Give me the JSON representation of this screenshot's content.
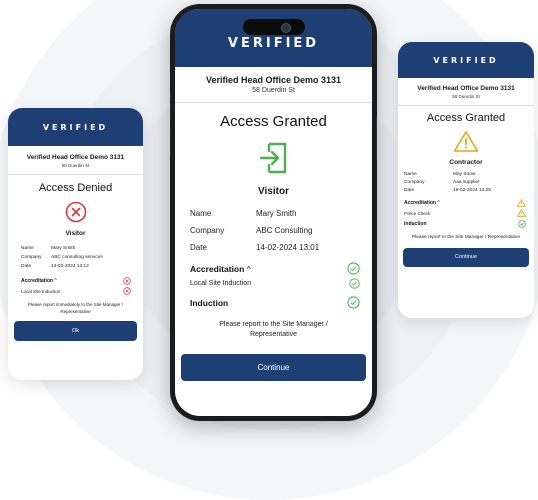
{
  "brand": {
    "logo_text": "VERIFIED",
    "header_color": "#1d3f73"
  },
  "colors": {
    "granted_green": "#4caf50",
    "denied_red": "#d63a3a",
    "warning_amber": "#e8a317"
  },
  "center": {
    "site_name": "Verified Head Office Demo 3131",
    "site_address": "58 Duerdin St",
    "status": "Access Granted",
    "status_icon": "door-enter-icon",
    "role": "Visitor",
    "fields": [
      {
        "label": "Name",
        "value": "Mary Smith"
      },
      {
        "label": "Company",
        "value": "ABC Consulting"
      },
      {
        "label": "Date",
        "value": "14-02-2024 13:01"
      }
    ],
    "accreditation_label": "Accreditation",
    "accreditation_items": [
      {
        "label": "Local Site Induction",
        "status": "ok"
      }
    ],
    "induction_label": "Induction",
    "note": "Please report to the Site Manager / Representative",
    "button_label": "Continue"
  },
  "left": {
    "site_name": "Verified Head Office Demo 3131",
    "site_address": "58 Duerdin St",
    "status": "Access Denied",
    "status_icon": "x-circle-icon",
    "role": "Visitor",
    "fields": [
      {
        "label": "Name",
        "value": "Mary Smith"
      },
      {
        "label": "Company",
        "value": "ABC consulting services"
      },
      {
        "label": "Date",
        "value": "14-02-2024 13:12"
      }
    ],
    "accreditation_label": "Accreditation",
    "accreditation_items": [
      {
        "label": "Local Site Induction",
        "status": "denied"
      }
    ],
    "note": "Please report immediately to the Site Manager / Representative",
    "button_label": "Ok"
  },
  "right": {
    "site_name": "Verified Head Office Demo 3131",
    "site_address": "58 Duerdin St",
    "status": "Access Granted",
    "status_icon": "warning-triangle-icon",
    "role": "Contractor",
    "fields": [
      {
        "label": "Name",
        "value": "May Snow"
      },
      {
        "label": "Company",
        "value": "Aaa supplier"
      },
      {
        "label": "Date",
        "value": "19-02-2024 13:25"
      }
    ],
    "accreditation_label": "Accreditation",
    "accreditation_items": [
      {
        "label": "Police Check",
        "status": "warning"
      }
    ],
    "induction_label": "Induction",
    "note": "Please report to the Site Manager / Representative",
    "button_label": "Continue"
  }
}
